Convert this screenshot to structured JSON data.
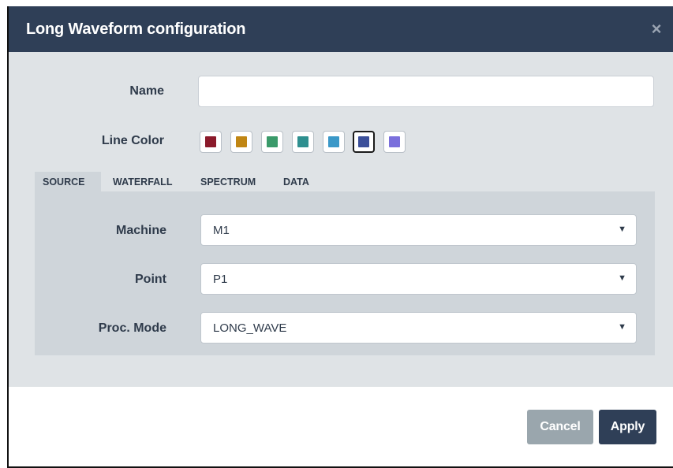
{
  "dialog": {
    "title": "Long Waveform configuration",
    "close_glyph": "×"
  },
  "form": {
    "name_label": "Name",
    "name_value": "",
    "name_placeholder": "",
    "line_color_label": "Line Color",
    "colors": [
      {
        "color": "#8b1a2b",
        "selected": false
      },
      {
        "color": "#c08614",
        "selected": false
      },
      {
        "color": "#3a9a6a",
        "selected": false
      },
      {
        "color": "#2e8f8f",
        "selected": false
      },
      {
        "color": "#3a98c8",
        "selected": false
      },
      {
        "color": "#3b4f9a",
        "selected": true
      },
      {
        "color": "#7a6fdc",
        "selected": false
      }
    ]
  },
  "tabs": [
    {
      "label": "SOURCE",
      "active": true
    },
    {
      "label": "WATERFALL",
      "active": false
    },
    {
      "label": "SPECTRUM",
      "active": false
    },
    {
      "label": "DATA",
      "active": false
    }
  ],
  "source": {
    "machine_label": "Machine",
    "machine_value": "M1",
    "point_label": "Point",
    "point_value": "P1",
    "proc_mode_label": "Proc. Mode",
    "proc_mode_value": "LONG_WAVE"
  },
  "footer": {
    "cancel_label": "Cancel",
    "apply_label": "Apply"
  },
  "theme": {
    "header_bg": "#2f3f57",
    "body_bg": "#dfe3e6",
    "panel_bg": "#cfd5da",
    "cancel_bg": "#9aa6ad",
    "apply_bg": "#2f3f57"
  }
}
